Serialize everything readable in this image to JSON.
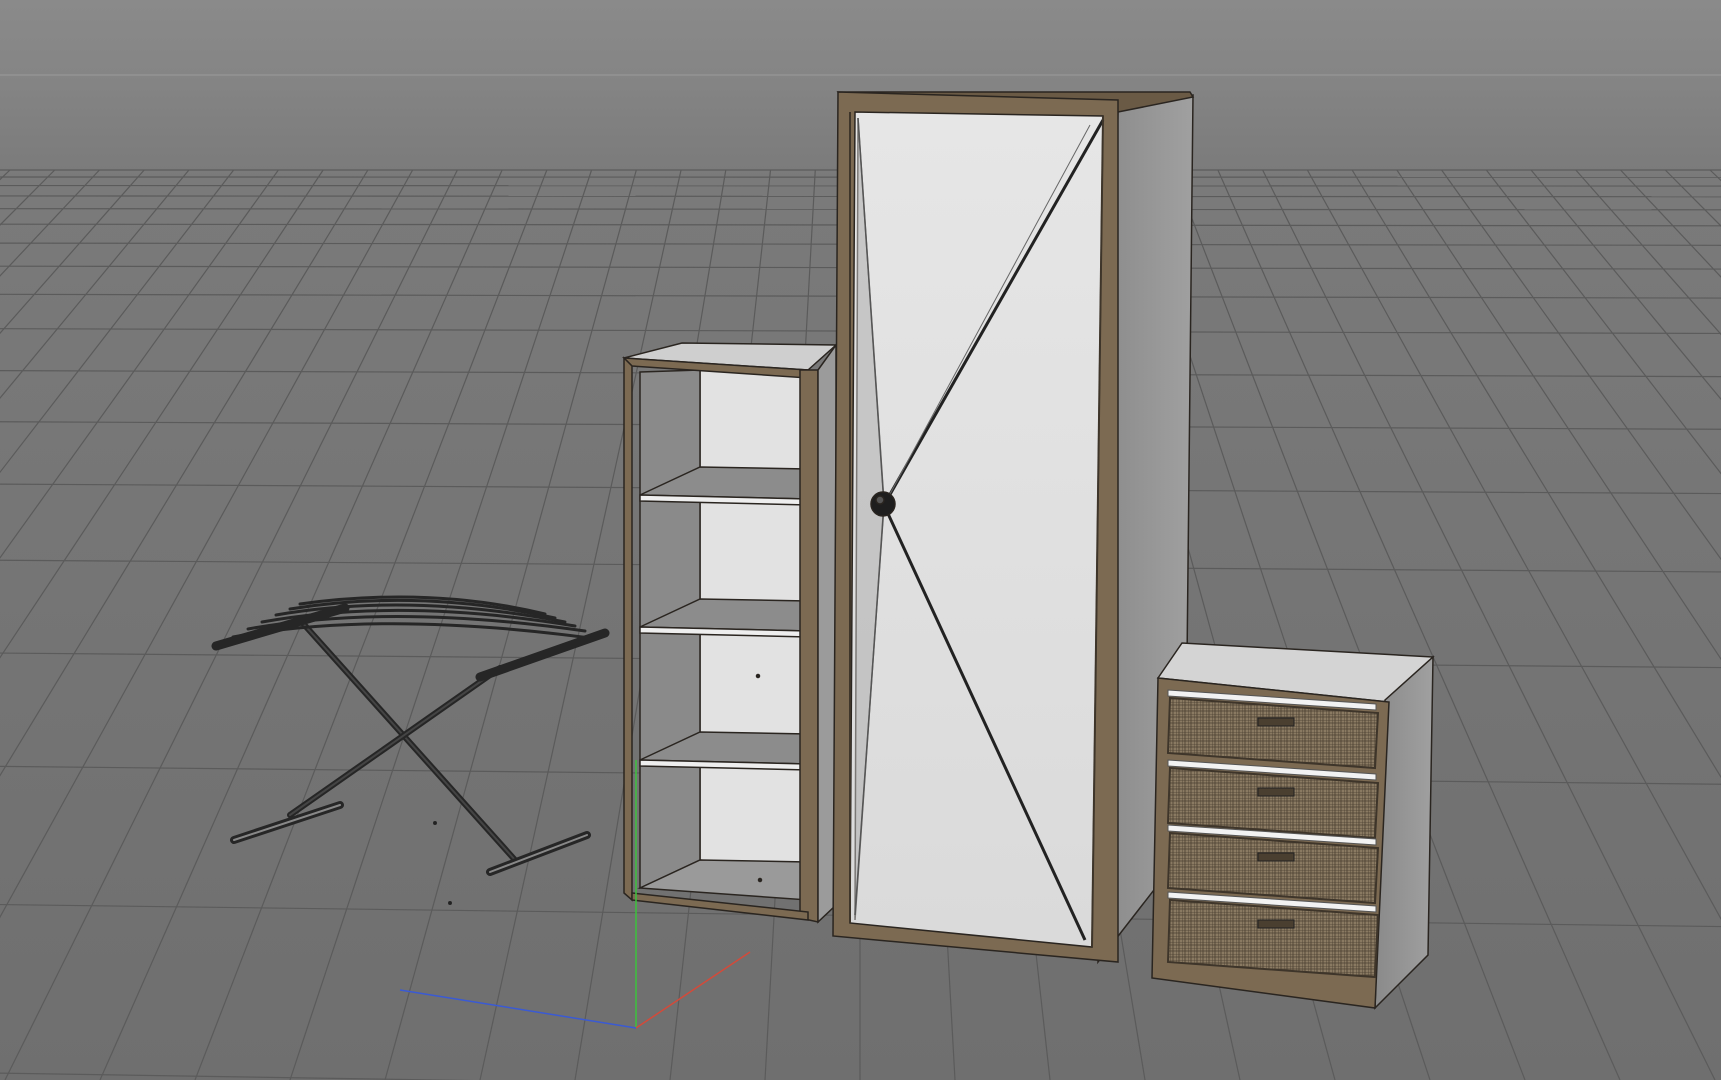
{
  "viewport": {
    "background_color": "#7a7a7a",
    "grid_color": "#5b5b5b",
    "horizon_line_color": "#9a9a9a"
  },
  "materials": {
    "wood_frame": "#7c6a52",
    "wood_frame_dark": "#3e352a",
    "white_panel": "#dcdcdc",
    "panel_shade": "#8e8e8e",
    "wicker": "#8a7a62",
    "metal": "#2a2a2a"
  },
  "axes": {
    "x_color": "#d44a3a",
    "y_color": "#3cc23c",
    "z_color": "#3a5ad4"
  },
  "objects": [
    {
      "name": "luggage-rack"
    },
    {
      "name": "open-bookshelf",
      "shelf_count": 3
    },
    {
      "name": "tall-wardrobe"
    },
    {
      "name": "drawer-cabinet",
      "drawer_count": 4
    }
  ]
}
